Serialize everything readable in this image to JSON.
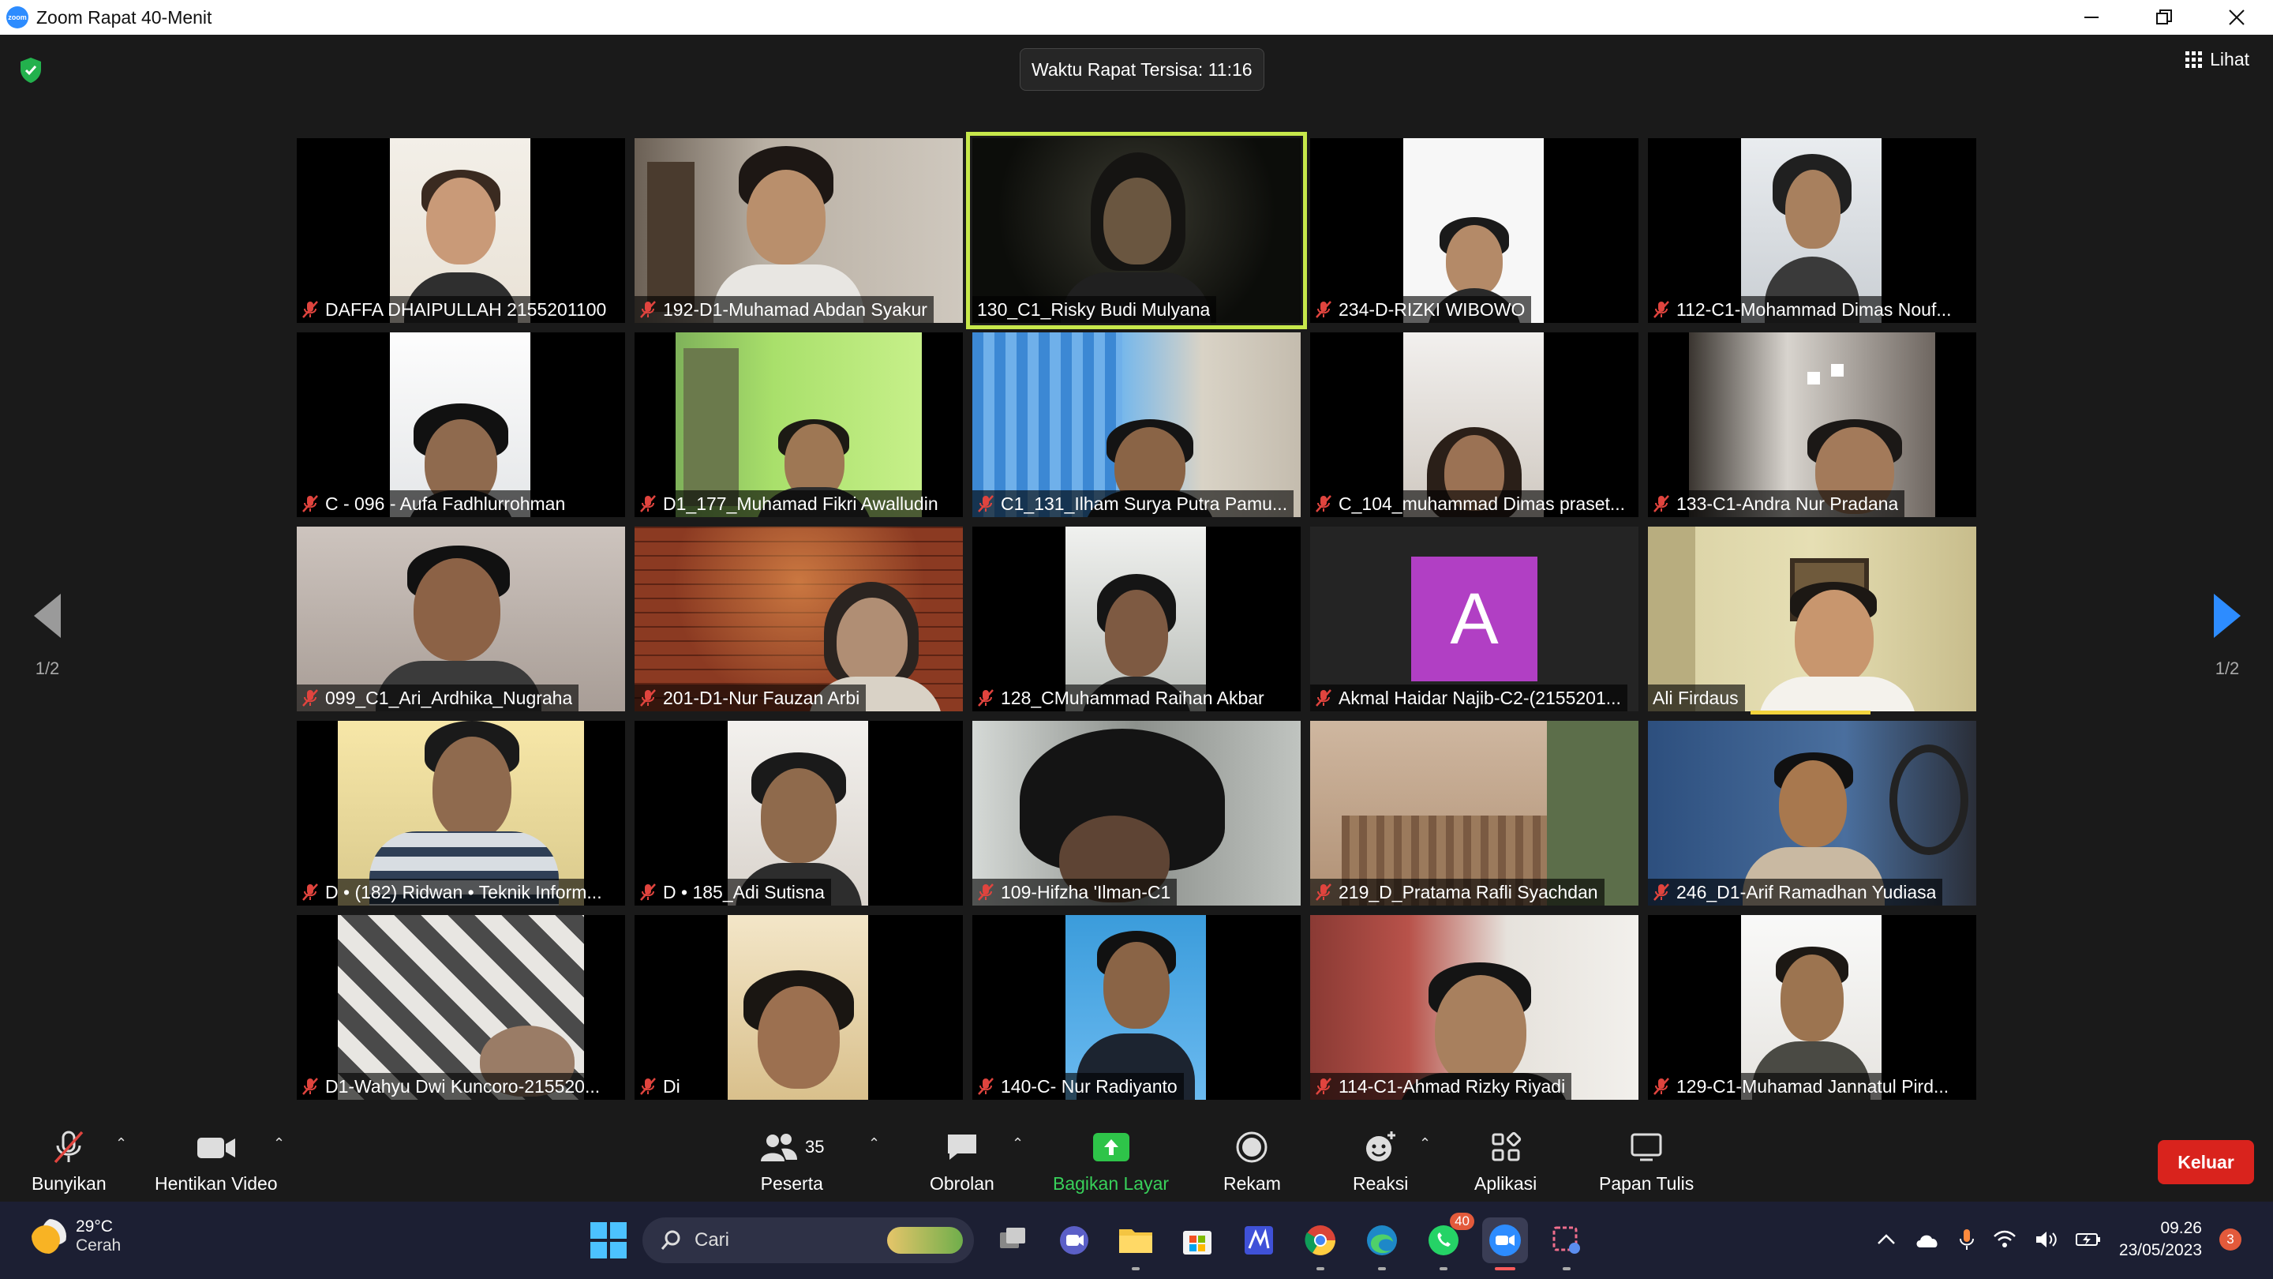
{
  "window": {
    "title": "Zoom Rapat 40-Menit",
    "logo_text": "zoom",
    "controls": [
      "minimize",
      "restore",
      "close"
    ]
  },
  "meeting": {
    "timer_text": "Waktu Rapat Tersisa: 11:16",
    "view_label": "Lihat",
    "page_indicator_left": "1/2",
    "page_indicator_right": "1/2",
    "security_icon": "shield-check-icon",
    "active_speaker_border_color": "#c7e84b"
  },
  "participants": [
    {
      "name": "DAFFA DHAIPULLAH 2155201100",
      "muted": true
    },
    {
      "name": "192-D1-Muhamad Abdan Syakur",
      "muted": true
    },
    {
      "name": "130_C1_Risky Budi Mulyana",
      "muted": false,
      "active": true
    },
    {
      "name": "234-D-RIZKI WIBOWO",
      "muted": true
    },
    {
      "name": "112-C1-Mohammad Dimas Nouf...",
      "muted": true
    },
    {
      "name": "C - 096 - Aufa Fadhlurrohman",
      "muted": true
    },
    {
      "name": "D1_177_Muhamad Fikri Awalludin",
      "muted": true
    },
    {
      "name": "C1_131_Ilham Surya Putra Pamu...",
      "muted": true
    },
    {
      "name": "C_104_muhammad Dimas praset...",
      "muted": true
    },
    {
      "name": "133-C1-Andra Nur Pradana",
      "muted": true
    },
    {
      "name": "099_C1_Ari_Ardhika_Nugraha",
      "muted": true
    },
    {
      "name": "201-D1-Nur Fauzan Arbi",
      "muted": true
    },
    {
      "name": "128_CMuhammad Raihan Akbar",
      "muted": true
    },
    {
      "name": "Akmal Haidar Najib-C2-(2155201...",
      "muted": true,
      "avatar_letter": "A"
    },
    {
      "name": "Ali Firdaus",
      "muted": false,
      "speaking": true
    },
    {
      "name": "D • (182) Ridwan • Teknik Inform...",
      "muted": true
    },
    {
      "name": "D • 185_Adi Sutisna",
      "muted": true
    },
    {
      "name": "109-Hifzha 'Ilman-C1",
      "muted": true
    },
    {
      "name": "219_D_Pratama Rafli Syachdan",
      "muted": true
    },
    {
      "name": "246_D1-Arif Ramadhan Yudiasa",
      "muted": true
    },
    {
      "name": "D1-Wahyu Dwi Kuncoro-215520...",
      "muted": true
    },
    {
      "name": "Di",
      "muted": true
    },
    {
      "name": "140-C- Nur Radiyanto",
      "muted": true
    },
    {
      "name": "114-C1-Ahmad Rizky Riyadi",
      "muted": true
    },
    {
      "name": "129-C1-Muhamad Jannatul Pird...",
      "muted": true
    }
  ],
  "toolbar": {
    "unmute_label": "Bunyikan",
    "stop_video_label": "Hentikan Video",
    "participants_label": "Peserta",
    "participants_count": "35",
    "chat_label": "Obrolan",
    "share_label": "Bagikan Layar",
    "record_label": "Rekam",
    "reactions_label": "Reaksi",
    "apps_label": "Aplikasi",
    "whiteboard_label": "Papan Tulis",
    "leave_label": "Keluar",
    "leave_color": "#d9231d",
    "share_color": "#2ec449"
  },
  "taskbar": {
    "temperature": "29°C",
    "weather": "Cerah",
    "search_placeholder": "Cari",
    "whatsapp_badge": "40",
    "time": "09.26",
    "date": "23/05/2023",
    "notification_count": "3"
  }
}
